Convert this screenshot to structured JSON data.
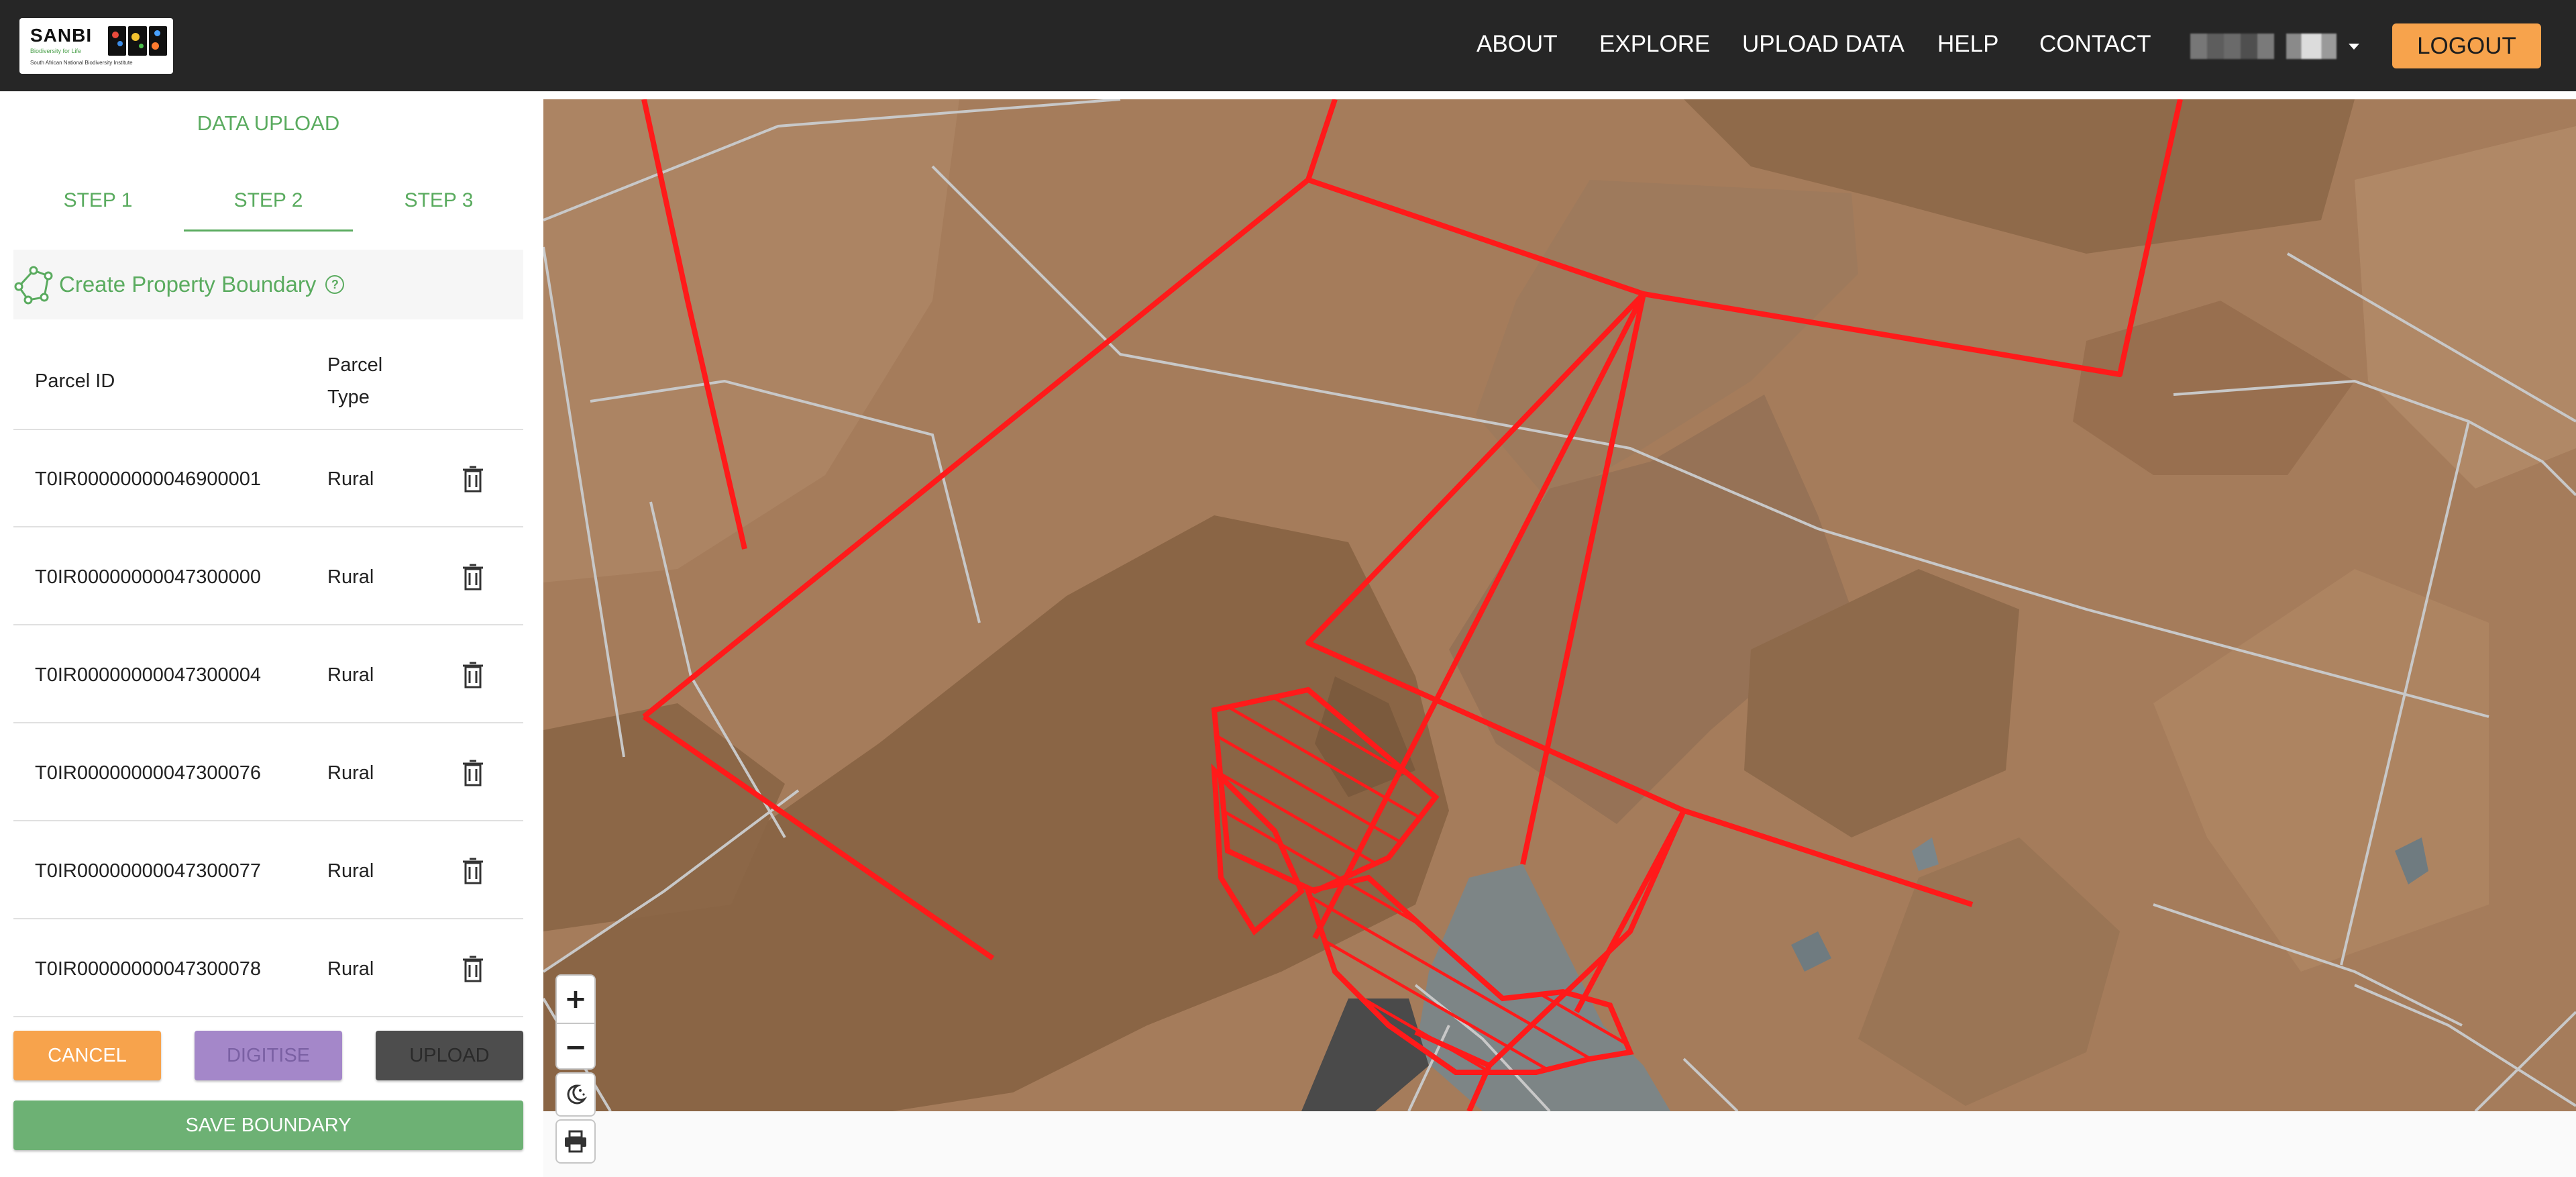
{
  "navbar": {
    "logo": {
      "text": "SANBI",
      "tagline": "Biodiversity for Life",
      "subtitle": "South African National Biodiversity Institute"
    },
    "links": [
      "ABOUT",
      "EXPLORE",
      "UPLOAD DATA",
      "HELP",
      "CONTACT"
    ],
    "user_menu": {
      "icon": "chevron-down-icon"
    },
    "logout_label": "LOGOUT",
    "colors": {
      "background": "#262626",
      "logout": "#f7a34c"
    }
  },
  "sidebar": {
    "title": "DATA UPLOAD",
    "tabs": [
      {
        "label": "STEP 1",
        "active": false
      },
      {
        "label": "STEP 2",
        "active": true
      },
      {
        "label": "STEP 3",
        "active": false
      }
    ],
    "boundary": {
      "label": "Create Property Boundary",
      "icon": "polygon-draw-icon",
      "help_icon": "help-circle-icon"
    },
    "table": {
      "columns": [
        "Parcel ID",
        "Parcel Type"
      ],
      "rows": [
        {
          "parcel_id": "T0IR00000000046900001",
          "parcel_type": "Rural"
        },
        {
          "parcel_id": "T0IR00000000047300000",
          "parcel_type": "Rural"
        },
        {
          "parcel_id": "T0IR00000000047300004",
          "parcel_type": "Rural"
        },
        {
          "parcel_id": "T0IR00000000047300076",
          "parcel_type": "Rural"
        },
        {
          "parcel_id": "T0IR00000000047300077",
          "parcel_type": "Rural"
        },
        {
          "parcel_id": "T0IR00000000047300078",
          "parcel_type": "Rural"
        }
      ],
      "row_action_icon": "trash-icon"
    },
    "buttons": {
      "cancel": "CANCEL",
      "digitise": "DIGITISE",
      "upload": "UPLOAD",
      "save_boundary": "SAVE BOUNDARY"
    },
    "colors": {
      "accent": "#5aab5f",
      "cancel": "#f7a34c",
      "digitise": "#a487c9",
      "upload": "#4d4d4d",
      "save": "#6db174"
    }
  },
  "map": {
    "controls": {
      "zoom_in": "+",
      "zoom_out": "−",
      "theme_icon": "moon-stars-icon",
      "print_icon": "printer-icon"
    },
    "colors": {
      "terrain": "#a57c5b",
      "boundary": "#ff1a1a",
      "parcel_lines": "#c8c8c8",
      "water": "#7d8586"
    }
  }
}
